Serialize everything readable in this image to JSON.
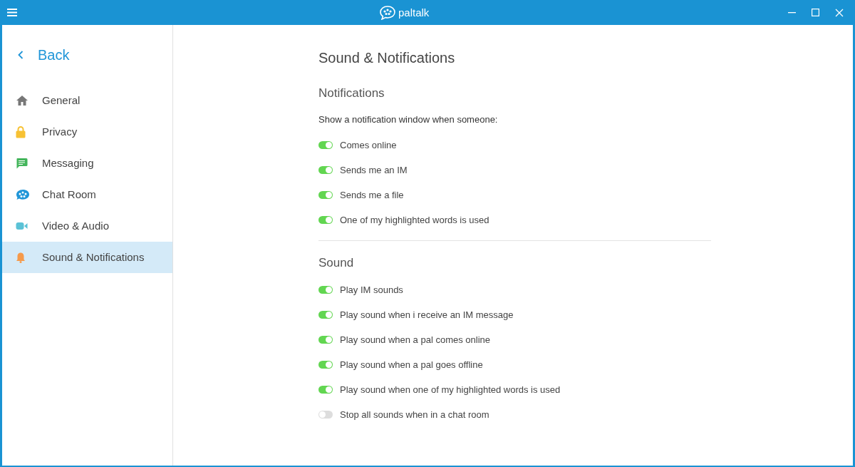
{
  "window": {
    "title": "paltalk"
  },
  "sidebar": {
    "back": "Back",
    "items": [
      {
        "label": "General",
        "kind": "home",
        "selected": false
      },
      {
        "label": "Privacy",
        "kind": "lock",
        "selected": false
      },
      {
        "label": "Messaging",
        "kind": "message",
        "selected": false
      },
      {
        "label": "Chat Room",
        "kind": "chatroom",
        "selected": false
      },
      {
        "label": "Video & Audio",
        "kind": "video",
        "selected": false
      },
      {
        "label": "Sound & Notifications",
        "kind": "bell",
        "selected": true
      }
    ]
  },
  "page": {
    "title": "Sound & Notifications",
    "sections": [
      {
        "heading": "Notifications",
        "intro": "Show a notification window when someone:",
        "options": [
          {
            "label": "Comes online",
            "on": true
          },
          {
            "label": "Sends me an IM",
            "on": true
          },
          {
            "label": "Sends me a file",
            "on": true
          },
          {
            "label": "One of my highlighted words is used",
            "on": true
          }
        ]
      },
      {
        "heading": "Sound",
        "options": [
          {
            "label": "Play IM sounds",
            "on": true
          },
          {
            "label": "Play sound when i receive an IM message",
            "on": true
          },
          {
            "label": "Play sound when a pal comes online",
            "on": true
          },
          {
            "label": "Play sound when a pal goes offline",
            "on": true
          },
          {
            "label": "Play sound when one of my highlighted words is used",
            "on": true
          },
          {
            "label": "Stop all sounds when in a chat room",
            "on": false
          }
        ]
      }
    ]
  }
}
